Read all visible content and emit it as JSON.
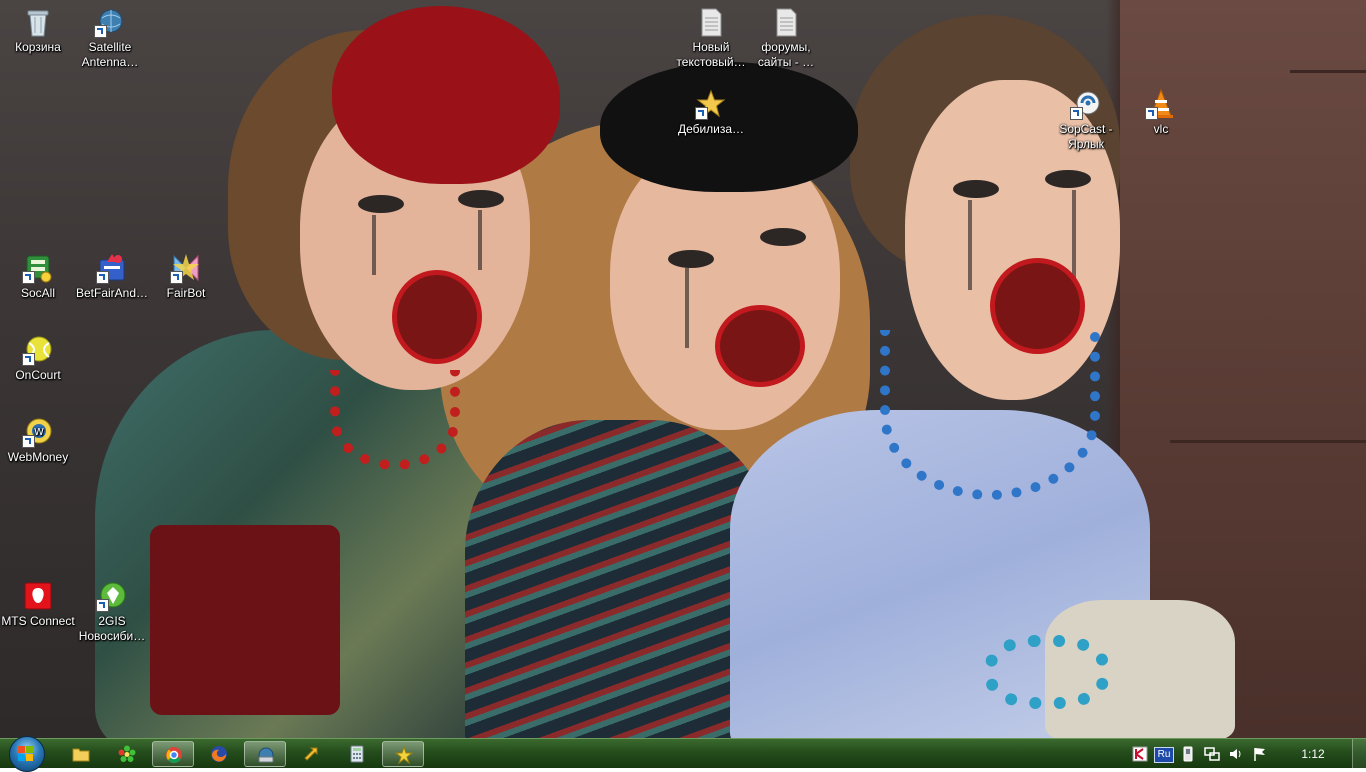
{
  "desktop": {
    "icons": [
      {
        "label": "Корзина",
        "icon": "recycle-bin-icon"
      },
      {
        "label": "Satellite Antenna…",
        "icon": "satellite-globe-icon"
      },
      {
        "label": "Новый текстовый…",
        "icon": "text-document-icon"
      },
      {
        "label": "форумы, сайты - …",
        "icon": "text-document-icon"
      },
      {
        "label": "Дебилиза…",
        "icon": "star-shortcut-icon"
      },
      {
        "label": "SopCast - Ярлык",
        "icon": "sopcast-icon"
      },
      {
        "label": "vlc",
        "icon": "vlc-cone-icon"
      },
      {
        "label": "SocAll",
        "icon": "socall-icon"
      },
      {
        "label": "BetFairAnd…",
        "icon": "betfair-icon"
      },
      {
        "label": "FairBot",
        "icon": "fairbot-icon"
      },
      {
        "label": "OnCourt",
        "icon": "oncourt-ball-icon"
      },
      {
        "label": "WebMoney",
        "icon": "webmoney-icon"
      },
      {
        "label": "MTS Connect",
        "icon": "mts-connect-icon"
      },
      {
        "label": "2GIS Новосиби…",
        "icon": "2gis-icon"
      }
    ]
  },
  "taskbar": {
    "start_icon": "windows-start-orb",
    "buttons": [
      {
        "icon": "explorer-folder-icon",
        "active": false
      },
      {
        "icon": "icq-flower-icon",
        "active": false
      },
      {
        "icon": "chrome-icon",
        "active": true
      },
      {
        "icon": "firefox-icon",
        "active": false
      },
      {
        "icon": "network-globe-icon",
        "active": true
      },
      {
        "icon": "torrent-arrows-icon",
        "active": false
      },
      {
        "icon": "calculator-icon",
        "active": false
      },
      {
        "icon": "star-app-icon",
        "active": true
      }
    ],
    "tray": {
      "keyboard_layout": "Ru",
      "icons": [
        "antivirus-k-icon",
        "language-ru-icon",
        "device-icon",
        "network-icon",
        "volume-icon",
        "action-center-flag-icon"
      ]
    },
    "clock": "1:12"
  },
  "colors": {
    "taskbar": "#244d1c",
    "label_text": "#ffffff"
  }
}
